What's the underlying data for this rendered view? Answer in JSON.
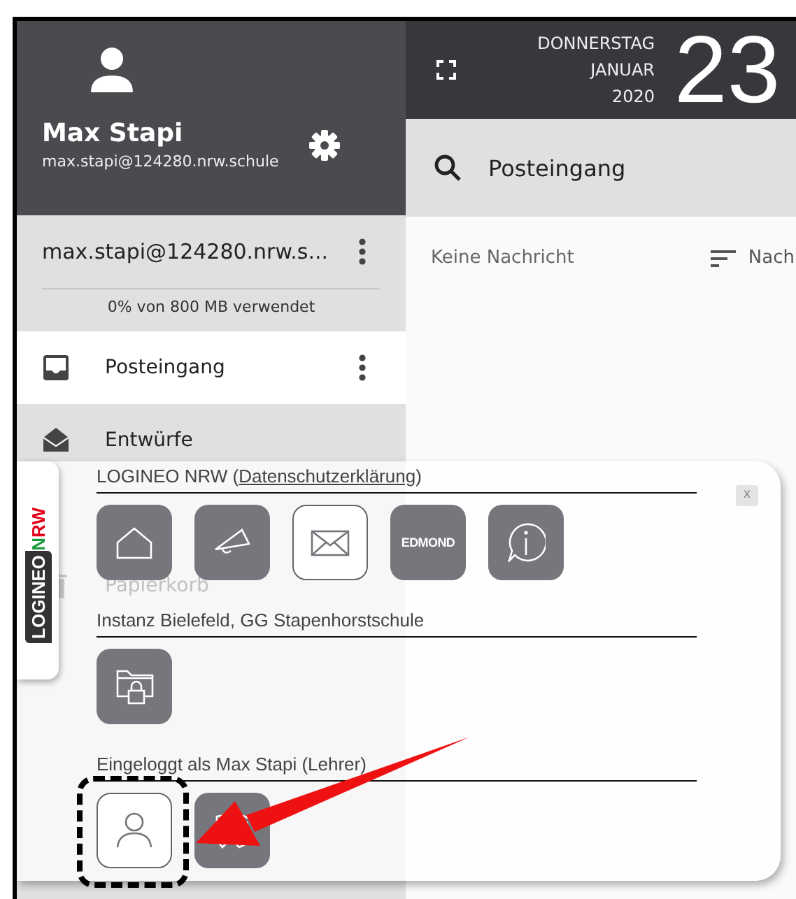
{
  "user": {
    "name": "Max Stapi",
    "email": "max.stapi@124280.nrw.schule"
  },
  "date": {
    "weekday": "DONNERSTAG",
    "month": "JANUAR",
    "year": "2020",
    "day": "23"
  },
  "search": {
    "value": "Posteingang"
  },
  "account": {
    "address": "max.stapi@124280.nrw.s...",
    "quota_text": "0% von 800 MB verwendet"
  },
  "folders": [
    {
      "label": "Posteingang",
      "kind": "inbox",
      "selected": true,
      "menu": true
    },
    {
      "label": "Entwürfe",
      "kind": "draft",
      "selected": false,
      "menu": false
    },
    {
      "kind": "spacer"
    },
    {
      "label": "Papierkorb",
      "kind": "trash",
      "selected": false,
      "menu": false
    }
  ],
  "message_list": {
    "empty_text": "Keine Nachricht",
    "sort_label": "Nach"
  },
  "launcher": {
    "brand": "LOGINEO",
    "brand_suffix": [
      {
        "text": "N",
        "color": "#1a9b3c"
      },
      {
        "text": "RW",
        "color": "#e2001a"
      }
    ],
    "close_label": "x",
    "sections": [
      {
        "title_before": "LOGINEO NRW (",
        "link": "Datenschutzerklärung",
        "title_after": ")",
        "apps": [
          {
            "kind": "home",
            "selected": false
          },
          {
            "kind": "megaphone",
            "selected": false
          },
          {
            "kind": "mail",
            "selected": true
          },
          {
            "kind": "edmond",
            "selected": false,
            "text": "EDMOND"
          },
          {
            "kind": "info",
            "selected": false
          }
        ]
      },
      {
        "title_before": "Instanz Bielefeld, GG Stapenhorstschule",
        "apps": [
          {
            "kind": "folder-lock",
            "selected": false
          }
        ]
      },
      {
        "title_before": "Eingeloggt als Max Stapi (Lehrer)",
        "apps": [
          {
            "kind": "user",
            "selected": true,
            "highlighted": true
          },
          {
            "kind": "tools",
            "selected": false
          }
        ]
      }
    ]
  }
}
